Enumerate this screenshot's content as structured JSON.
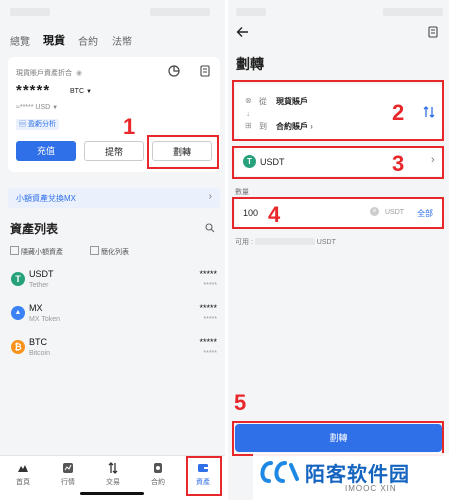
{
  "left": {
    "tabs": [
      {
        "label": "總覽"
      },
      {
        "label": "現貨"
      },
      {
        "label": "合約"
      },
      {
        "label": "法幣"
      }
    ],
    "card": {
      "title": "現貨賬戶資產折合",
      "balance_masked": "*****",
      "balance_unit": "BTC",
      "usd_masked": "≈***** USD",
      "pnl_badge": "盈虧分析",
      "buttons": {
        "deposit": "充值",
        "withdraw": "提幣",
        "transfer": "劃轉"
      }
    },
    "convert_banner": "小額資產兌換MX",
    "asset_list": {
      "title": "資產列表",
      "hide_small": "隱藏小額資產",
      "simplified": "簡化列表",
      "items": [
        {
          "symbol": "USDT",
          "name": "Tether",
          "balance": "*****",
          "value": "*****",
          "color": "#26a17b",
          "icon_char": "T"
        },
        {
          "symbol": "MX",
          "name": "MX Token",
          "balance": "*****",
          "value": "*****",
          "color": "#3b82f6",
          "icon_char": "▲"
        },
        {
          "symbol": "BTC",
          "name": "Bitcoin",
          "balance": "*****",
          "value": "*****",
          "color": "#f7931a",
          "icon_char": "₿"
        }
      ]
    },
    "nav": [
      {
        "label": "首頁"
      },
      {
        "label": "行情"
      },
      {
        "label": "交易"
      },
      {
        "label": "合約"
      },
      {
        "label": "資產"
      }
    ]
  },
  "right": {
    "title": "劃轉",
    "from_label": "從",
    "from_value": "現貨賬戶",
    "to_label": "到",
    "to_value": "合約賬戶",
    "coin": "USDT",
    "qty_label": "數量",
    "qty_value": "100",
    "qty_unit": "USDT",
    "qty_all": "全部",
    "available_label": "可用 :",
    "available_unit": "USDT",
    "submit": "劃轉"
  },
  "annotations": [
    "1",
    "2",
    "3",
    "4",
    "5"
  ],
  "watermark": {
    "main": "陌客软件园",
    "sub": "IMOOC XIN"
  },
  "colors": {
    "accent": "#2f6fe8",
    "highlight": "#e8272b",
    "usdt": "#26a17b"
  }
}
